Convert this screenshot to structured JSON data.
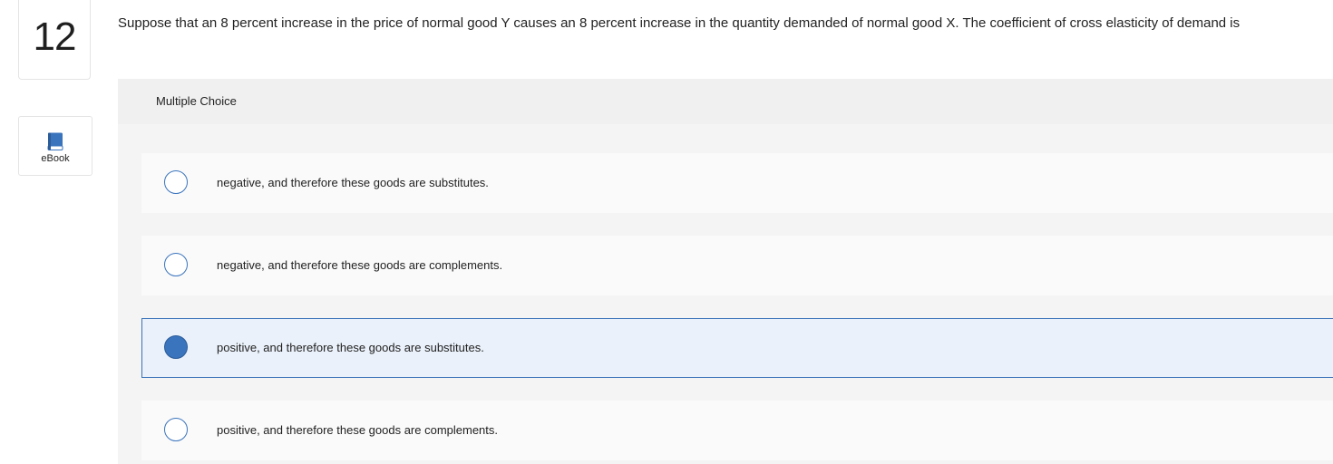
{
  "question": {
    "number": "12",
    "text": "Suppose that an 8 percent increase in the price of normal good Y causes an 8 percent increase in the quantity demanded of normal good X. The coefficient of cross elasticity of demand is"
  },
  "sidebar": {
    "ebook_label": "eBook",
    "ebook_icon": "book-icon",
    "accent_color": "#3a74bd"
  },
  "multiple_choice": {
    "title": "Multiple Choice",
    "options": [
      {
        "label": "negative, and therefore these goods are substitutes.",
        "selected": false
      },
      {
        "label": "negative, and therefore these goods are complements.",
        "selected": false
      },
      {
        "label": "positive, and therefore these goods are substitutes.",
        "selected": true
      },
      {
        "label": "positive, and therefore these goods are complements.",
        "selected": false
      }
    ]
  }
}
